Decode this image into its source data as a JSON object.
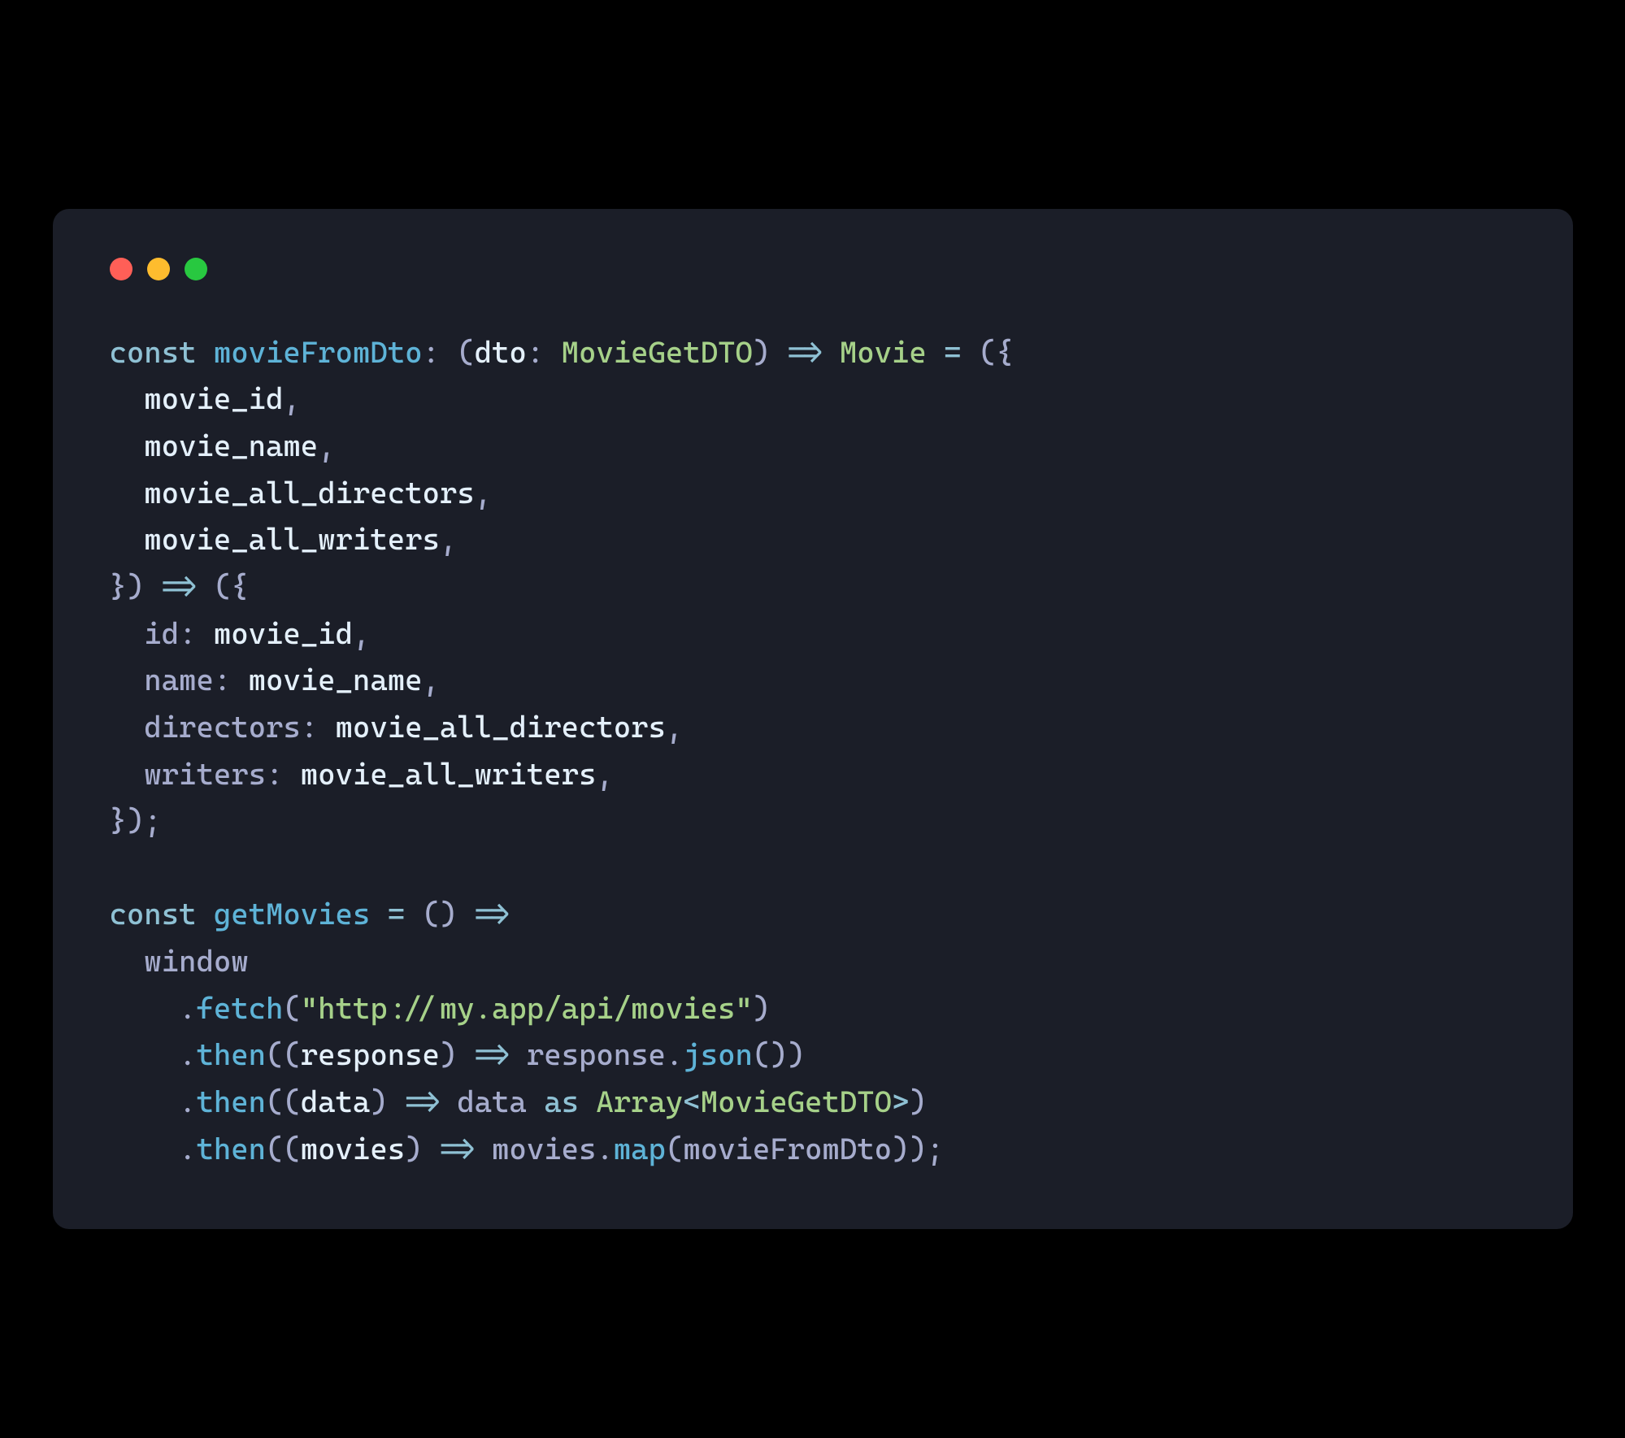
{
  "colors": {
    "background": "#000000",
    "window_bg": "#1b1e28",
    "traffic_red": "#ff5f57",
    "traffic_yellow": "#febc2e",
    "traffic_green": "#28c840",
    "keyword": "#8fc1d4",
    "identifier": "#a6accd",
    "type": "#a6d189",
    "string": "#a6d189",
    "call": "#5eb3d7",
    "param": "#e4f0fb"
  },
  "code": {
    "line1": {
      "kw_const": "const",
      "fn_name": "movieFromDto",
      "colon1": ":",
      "paren_o1": "(",
      "param_dto": "dto",
      "colon2": ":",
      "type_dto": "MovieGetDTO",
      "paren_c1": ")",
      "arrow1": "=>",
      "type_movie": "Movie",
      "eq": "=",
      "paren_o2": "(",
      "brace_o": "{"
    },
    "destruct": {
      "movie_id": "movie_id",
      "movie_name": "movie_name",
      "movie_all_directors": "movie_all_directors",
      "movie_all_writers": "movie_all_writers",
      "comma": ","
    },
    "line6": {
      "brace_c": "}",
      "paren_c": ")",
      "arrow": "=>",
      "paren_o": "(",
      "brace_o": "{"
    },
    "body": {
      "id_key": "id",
      "id_val": "movie_id",
      "name_key": "name",
      "name_val": "movie_name",
      "directors_key": "directors",
      "directors_val": "movie_all_directors",
      "writers_key": "writers",
      "writers_val": "movie_all_writers",
      "colon": ":",
      "comma": ","
    },
    "line11": {
      "brace_c": "}",
      "paren_c": ")",
      "semi": ";"
    },
    "line13": {
      "kw_const": "const",
      "fn_name": "getMovies",
      "eq": "=",
      "parens": "()",
      "arrow": "=>"
    },
    "line14": {
      "window": "window"
    },
    "line15": {
      "dot": ".",
      "fetch": "fetch",
      "paren_o": "(",
      "url": "\"http://my.app/api/movies\"",
      "paren_c": ")"
    },
    "line16": {
      "dot": ".",
      "then": "then",
      "paren_o1": "(",
      "paren_o2": "(",
      "response": "response",
      "paren_c1": ")",
      "arrow": "=>",
      "response2": "response",
      "dot2": ".",
      "json": "json",
      "parens": "()",
      "paren_c2": ")"
    },
    "line17": {
      "dot": ".",
      "then": "then",
      "paren_o1": "(",
      "paren_o2": "(",
      "data": "data",
      "paren_c1": ")",
      "arrow": "=>",
      "data2": "data",
      "as": "as",
      "array": "Array",
      "lt": "<",
      "dto": "MovieGetDTO",
      "gt": ">",
      "paren_c2": ")"
    },
    "line18": {
      "dot": ".",
      "then": "then",
      "paren_o1": "(",
      "paren_o2": "(",
      "movies": "movies",
      "paren_c1": ")",
      "arrow": "=>",
      "movies2": "movies",
      "dot2": ".",
      "map": "map",
      "paren_o3": "(",
      "movieFromDto": "movieFromDto",
      "paren_c3": ")",
      "paren_c2": ")",
      "semi": ";"
    }
  }
}
